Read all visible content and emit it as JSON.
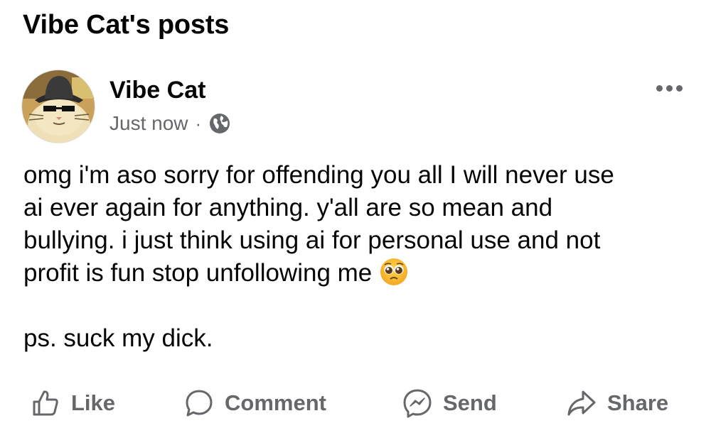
{
  "page": {
    "title": "Vibe Cat's posts"
  },
  "post": {
    "author": "Vibe Cat",
    "timestamp": "Just now",
    "separator": "·",
    "audience_icon": "globe-icon",
    "menu_icon": "more-options-icon",
    "text_lines": [
      "omg i'm aso sorry for offending you all I will never use",
      "ai ever again for anything. y'all are so mean and",
      "bullying. i just think using ai for personal use and not",
      "profit is fun stop unfollowing me"
    ],
    "emoji": "pleading-face-emoji",
    "ps_line": "ps. suck my dick."
  },
  "actions": {
    "like": "Like",
    "comment": "Comment",
    "send": "Send",
    "share": "Share"
  },
  "colors": {
    "text_primary": "#050505",
    "text_secondary": "#65676b",
    "background": "#ffffff"
  }
}
